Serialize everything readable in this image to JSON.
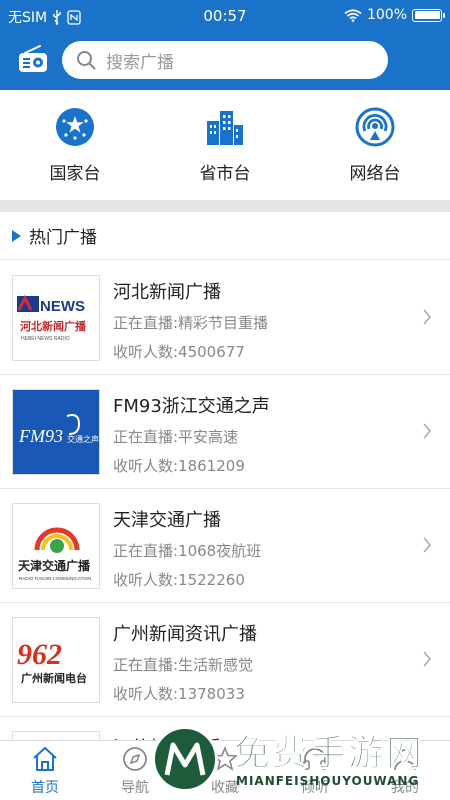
{
  "status_bar": {
    "carrier": "无SIM",
    "time": "00:57",
    "battery_text": "100%",
    "battery_level": 1.0
  },
  "search": {
    "placeholder": "搜索广播"
  },
  "categories": [
    {
      "label": "国家台",
      "icon": "national-flag-icon"
    },
    {
      "label": "省市台",
      "icon": "buildings-icon"
    },
    {
      "label": "网络台",
      "icon": "signal-broadcast-icon"
    }
  ],
  "section": {
    "title": "热门广播"
  },
  "stations": [
    {
      "name": "河北新闻广播",
      "live": "正在直播:精彩节目重播",
      "listeners": "收听人数:4500677",
      "logo_text": "NEWS",
      "logo_sub": "河北新闻广播",
      "logo_caption": "HEBEI NEWS RADIO"
    },
    {
      "name": "FM93浙江交通之声",
      "live": "正在直播:平安高速",
      "listeners": "收听人数:1861209",
      "logo_text": "FM93",
      "logo_sub": "交通之声"
    },
    {
      "name": "天津交通广播",
      "live": "正在直播:1068夜航班",
      "listeners": "收听人数:1522260",
      "logo_text": "天津交通广播",
      "logo_caption": "RADIO TIANJIN COMMUNICATION"
    },
    {
      "name": "广州新闻资讯广播",
      "live": "正在直播:生活新感觉",
      "listeners": "收听人数:1378033",
      "logo_text": "962",
      "logo_sub": "广州新闻电台"
    },
    {
      "name": "江苏新闻广播"
    }
  ],
  "tabs": [
    {
      "label": "首页",
      "icon": "home-icon",
      "active": true
    },
    {
      "label": "导航",
      "icon": "compass-icon",
      "active": false
    },
    {
      "label": "收藏",
      "icon": "star-icon",
      "active": false
    },
    {
      "label": "倾听",
      "icon": "headphones-icon",
      "active": false
    },
    {
      "label": "我的",
      "icon": "user-icon",
      "active": false
    }
  ],
  "watermark": {
    "title": "免费手游网",
    "subtitle": "MIANFEISHOUYOUWANG"
  },
  "colors": {
    "brand_blue": "#1a73c9",
    "divider_gray": "#e6e6e6",
    "watermark_green": "#1e4d33"
  }
}
